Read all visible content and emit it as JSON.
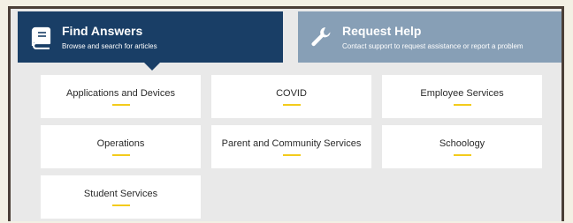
{
  "tabs": {
    "find_answers": {
      "title": "Find Answers",
      "subtitle": "Browse and search for articles",
      "icon": "book-icon",
      "color": "#193e66"
    },
    "request_help": {
      "title": "Request Help",
      "subtitle": "Contact support to request assistance or report a problem",
      "icon": "wrench-icon",
      "color": "#879fb6"
    }
  },
  "categories": [
    "Applications and Devices",
    "COVID",
    "Employee Services",
    "Operations",
    "Parent and Community Services",
    "Schoology",
    "Student Services"
  ],
  "accent_color": "#f3cb1c",
  "frame_color": "#4b3f37"
}
